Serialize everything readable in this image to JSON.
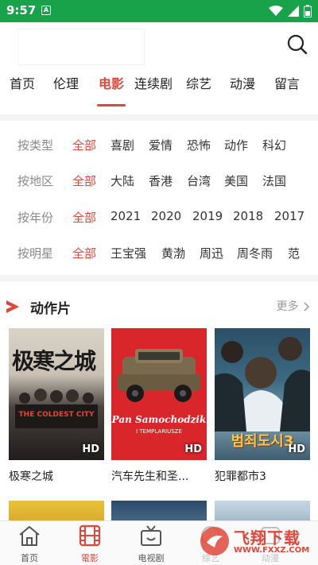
{
  "status_bar": {
    "time": "9:57",
    "notif_icon": "A"
  },
  "header": {
    "search_icon": "search-icon"
  },
  "nav_tabs": [
    {
      "label": "首页"
    },
    {
      "label": "伦理"
    },
    {
      "label": "电影",
      "active": true
    },
    {
      "label": "连续剧"
    },
    {
      "label": "综艺"
    },
    {
      "label": "动漫"
    },
    {
      "label": "留言"
    }
  ],
  "filters": {
    "type": {
      "label": "按类型",
      "options": [
        "全部",
        "喜剧",
        "爱情",
        "恐怖",
        "动作",
        "科幻"
      ]
    },
    "region": {
      "label": "按地区",
      "options": [
        "全部",
        "大陆",
        "香港",
        "台湾",
        "美国",
        "法国"
      ]
    },
    "year": {
      "label": "按年份",
      "options": [
        "全部",
        "2021",
        "2020",
        "2019",
        "2018",
        "2017"
      ]
    },
    "star": {
      "label": "按明星",
      "options": [
        "全部",
        "王宝强",
        "黄渤",
        "周迅",
        "周冬雨",
        "范"
      ]
    }
  },
  "section": {
    "title": "动作片",
    "more": "更多"
  },
  "movies": [
    {
      "title": "极寒之城",
      "badge": "HD",
      "poster_text": "极寒之城",
      "poster_sub": "THE COLDEST CITY"
    },
    {
      "title": "汽车先生和圣...",
      "badge": "HD",
      "poster_text": "Pan Samochodzik",
      "poster_sub": "I TEMPLARIUSZE"
    },
    {
      "title": "犯罪都市3",
      "badge": "HD",
      "poster_text": "범죄도시3"
    }
  ],
  "bottom_nav": [
    {
      "label": "首页",
      "icon": "home-icon"
    },
    {
      "label": "電影",
      "icon": "film-icon",
      "active": true
    },
    {
      "label": "电视剧",
      "icon": "tv-icon"
    },
    {
      "label": "综艺",
      "icon": "variety-icon"
    },
    {
      "label": "动漫",
      "icon": "anime-icon"
    }
  ],
  "watermark": {
    "text": "飞翔下载",
    "url": "WWW.FXXZ.COM"
  },
  "colors": {
    "status_bar": "#18a34a",
    "accent": "#e0473b"
  }
}
